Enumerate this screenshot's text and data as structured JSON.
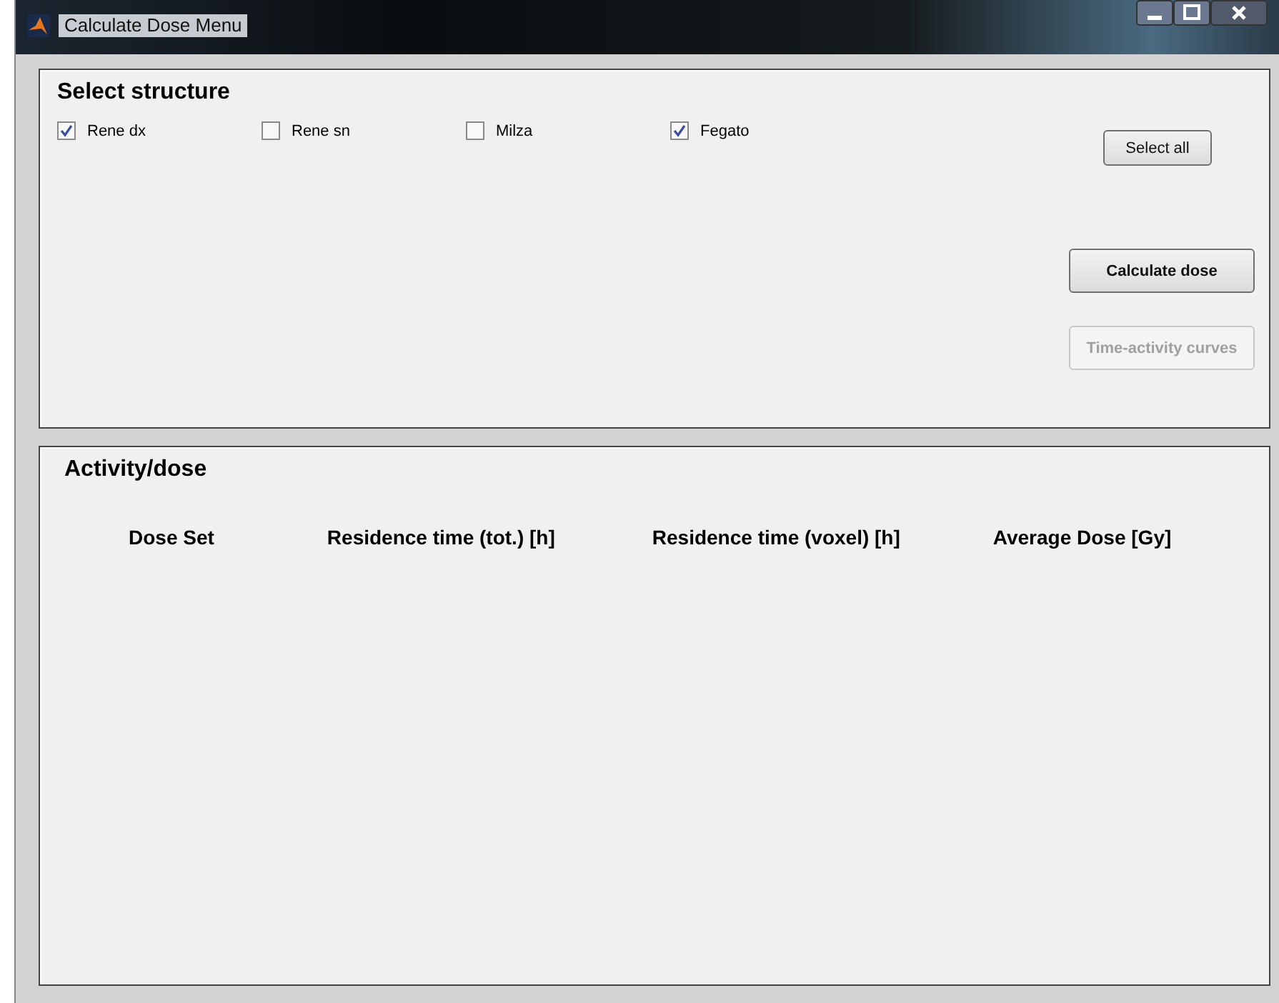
{
  "window": {
    "title": "Calculate Dose Menu"
  },
  "select_structure": {
    "title": "Select structure",
    "checkboxes": [
      {
        "label": "Rene dx",
        "checked": true
      },
      {
        "label": "Rene sn",
        "checked": false
      },
      {
        "label": "Milza",
        "checked": false
      },
      {
        "label": "Fegato",
        "checked": true
      }
    ],
    "buttons": [
      {
        "label": "Select all",
        "disabled": false,
        "kind": "small"
      },
      {
        "label": "Calculate dose",
        "disabled": false,
        "kind": "large"
      },
      {
        "label": "Time-activity curves",
        "disabled": true,
        "kind": "large"
      }
    ]
  },
  "activity_dose": {
    "title": "Activity/dose",
    "columns": [
      "Dose Set",
      "Residence time (tot.) [h]",
      "Residence time (voxel) [h]",
      "Average Dose [Gy]"
    ]
  }
}
